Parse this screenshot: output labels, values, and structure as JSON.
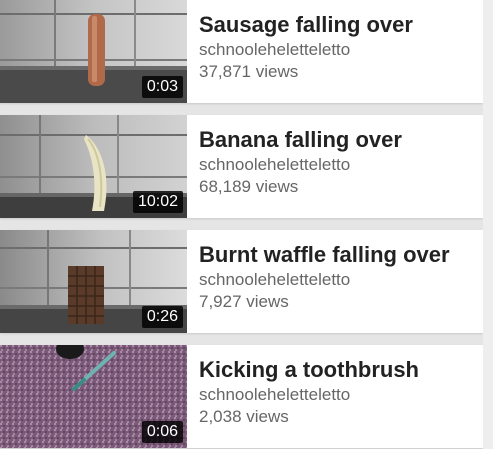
{
  "videos": [
    {
      "title": "Sausage falling over",
      "channel": "schnooleheletteletto",
      "views": "37,871 views",
      "duration": "0:03",
      "thumb_icon": "sausage-thumbnail"
    },
    {
      "title": "Banana falling over",
      "channel": "schnooleheletteletto",
      "views": "68,189 views",
      "duration": "10:02",
      "thumb_icon": "banana-thumbnail"
    },
    {
      "title": "Burnt waffle falling over",
      "channel": "schnooleheletteletto",
      "views": "7,927 views",
      "duration": "0:26",
      "thumb_icon": "waffle-thumbnail"
    },
    {
      "title": "Kicking a toothbrush",
      "channel": "schnooleheletteletto",
      "views": "2,038 views",
      "duration": "0:06",
      "thumb_icon": "toothbrush-thumbnail"
    }
  ],
  "colors": {
    "title": "#222222",
    "secondary": "#666666",
    "background": "#e5e5e5",
    "duration_badge": "#000000"
  }
}
